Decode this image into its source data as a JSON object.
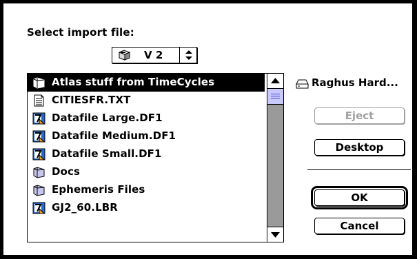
{
  "dialog": {
    "prompt": "Select import file:",
    "volume_popup": {
      "label": "V 2",
      "icon": "volume-icon"
    },
    "file_list": {
      "items": [
        {
          "name": "Atlas stuff from TimeCycles",
          "icon": "folder-icon",
          "selected": true
        },
        {
          "name": "CITIESFR.TXT",
          "icon": "text-document-icon",
          "selected": false
        },
        {
          "name": "Datafile Large.DF1",
          "icon": "app-document-icon",
          "selected": false
        },
        {
          "name": "Datafile Medium.DF1",
          "icon": "app-document-icon",
          "selected": false
        },
        {
          "name": "Datafile Small.DF1",
          "icon": "app-document-icon",
          "selected": false
        },
        {
          "name": "Docs",
          "icon": "folder-icon",
          "selected": false
        },
        {
          "name": "Ephemeris Files",
          "icon": "folder-icon",
          "selected": false
        },
        {
          "name": "GJ2_60.LBR",
          "icon": "app-document-icon",
          "selected": false
        }
      ]
    },
    "drive": {
      "name": "Raghus Hard...",
      "icon": "hard-disk-icon"
    },
    "buttons": {
      "eject": "Eject",
      "desktop": "Desktop",
      "ok": "OK",
      "cancel": "Cancel"
    }
  }
}
